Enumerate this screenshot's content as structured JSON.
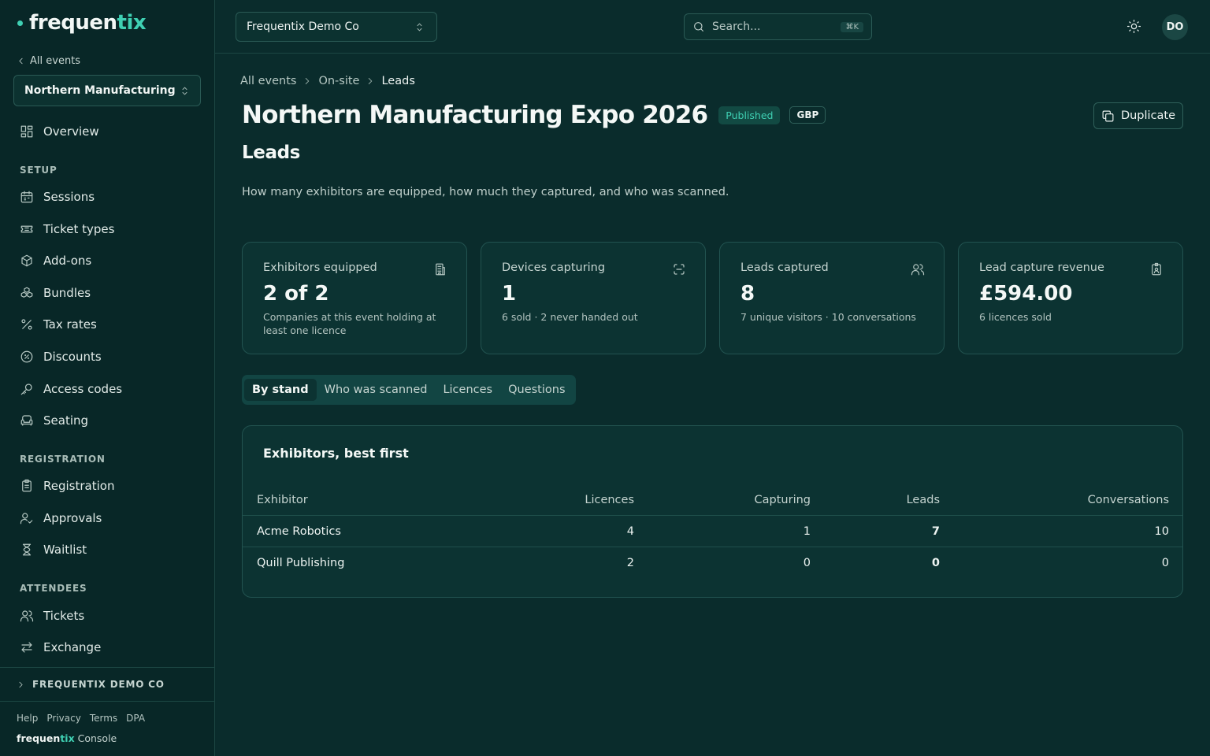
{
  "brand": {
    "name_a": "frequen",
    "name_b": "tix",
    "footer_a": "frequen",
    "footer_b": "tix",
    "footer_c": " Console"
  },
  "sidebar": {
    "back_label": "All events",
    "event_select": "Northern Manufacturing ...",
    "overview": "Overview",
    "sections": {
      "setup": "SETUP",
      "registration": "REGISTRATION",
      "attendees": "ATTENDEES"
    },
    "setup_items": [
      "Sessions",
      "Ticket types",
      "Add-ons",
      "Bundles",
      "Tax rates",
      "Discounts",
      "Access codes",
      "Seating"
    ],
    "registration_items": [
      "Registration",
      "Approvals",
      "Waitlist"
    ],
    "attendee_items": [
      "Tickets",
      "Exchange"
    ],
    "org": "FREQUENTIX DEMO CO",
    "footer_links": [
      "Help",
      "Privacy",
      "Terms",
      "DPA"
    ]
  },
  "topbar": {
    "org_select": "Frequentix Demo Co",
    "search_placeholder": "Search...",
    "search_shortcut": "⌘K",
    "avatar": "DO"
  },
  "breadcrumb": [
    "All events",
    "On-site",
    "Leads"
  ],
  "page": {
    "title": "Northern Manufacturing Expo 2026",
    "status_badge": "Published",
    "currency_badge": "GBP",
    "duplicate_label": "Duplicate",
    "subtitle": "Leads",
    "description": "How many exhibitors are equipped, how much they captured, and who was scanned."
  },
  "stats": [
    {
      "label": "Exhibitors equipped",
      "value": "2 of 2",
      "sub": "Companies at this event holding at least one licence",
      "icon": "building-icon"
    },
    {
      "label": "Devices capturing",
      "value": "1",
      "sub": "6 sold · 2 never handed out",
      "icon": "scan-icon"
    },
    {
      "label": "Leads captured",
      "value": "8",
      "sub": "7 unique visitors · 10 conversations",
      "icon": "users-icon"
    },
    {
      "label": "Lead capture revenue",
      "value": "£594.00",
      "sub": "6 licences sold",
      "icon": "badge-icon"
    }
  ],
  "tabs": [
    "By stand",
    "Who was scanned",
    "Licences",
    "Questions"
  ],
  "table": {
    "title": "Exhibitors, best first",
    "columns": [
      "Exhibitor",
      "Licences",
      "Capturing",
      "Leads",
      "Conversations"
    ],
    "rows": [
      [
        "Acme Robotics",
        "4",
        "1",
        "7",
        "10"
      ],
      [
        "Quill Publishing",
        "2",
        "0",
        "0",
        "0"
      ]
    ]
  },
  "colors": {
    "accent": "#3fd0b3",
    "background": "#0a2c2c",
    "sidebar": "#082727",
    "card": "#0c3332"
  }
}
